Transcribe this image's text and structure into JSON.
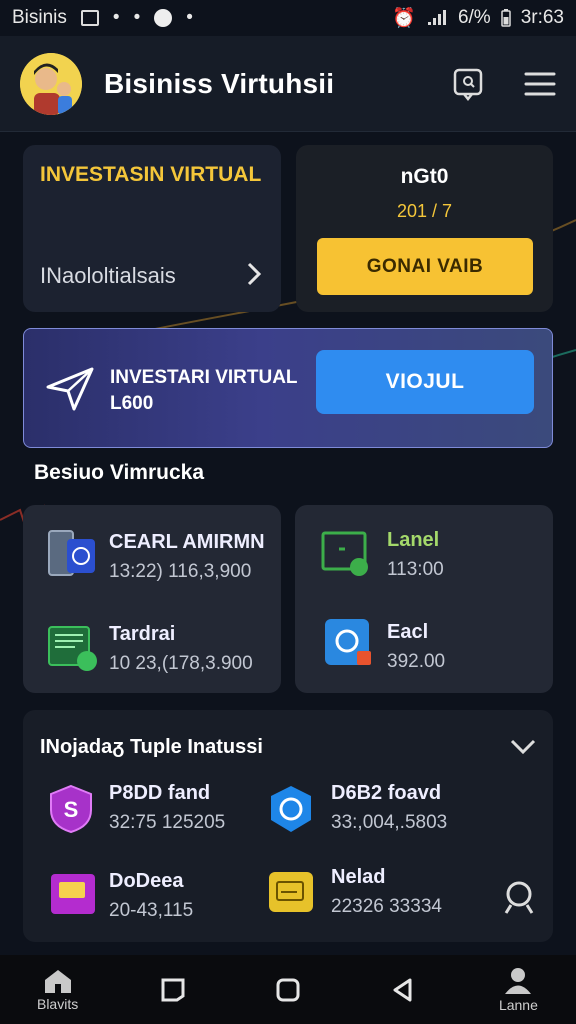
{
  "status_bar": {
    "carrier": "Bisinis",
    "battery": "6/%",
    "time": "3r:63"
  },
  "app_bar": {
    "title": "Bisiniss Virtuhsii"
  },
  "cards": {
    "invest_card": {
      "title": "INVESTASIN VIRTUAL",
      "subtitle": "INaololtialsais"
    },
    "balance_card": {
      "title": "nGt0",
      "value": "201 / 7",
      "button_label": "GONAI VAIB"
    },
    "banner": {
      "line1": "INVESTARI VIRTUAL",
      "line2": "L600",
      "button_label": "VIOJUL"
    }
  },
  "section_title": "Besiuo Vimrucka",
  "asset_cards": [
    {
      "items": [
        {
          "title": "CEARL AMIRMN",
          "value": "13:22) 116,3,900"
        },
        {
          "title": "Tardrai",
          "value": "10 23,(178,3.900"
        }
      ]
    },
    {
      "items": [
        {
          "title": "Lanel",
          "value": "113:00"
        },
        {
          "title": "Eacl",
          "value": "392.00"
        }
      ]
    }
  ],
  "list_section": {
    "title": "INojadaᵹ Tuple Inatussi",
    "items": [
      {
        "title": "P8DD  fand",
        "value": "32:75 125205"
      },
      {
        "title": "D6B2 foavd",
        "value": "33:,004,.5803"
      },
      {
        "title": "DoDeea",
        "value": "20-43,115"
      },
      {
        "title": "Nelad",
        "value": "22326 33334"
      }
    ]
  },
  "bottom_nav": {
    "home_label": "Blavits",
    "profile_label": "Lanne"
  },
  "colors": {
    "accent_yellow": "#f7c233",
    "accent_blue": "#2f8cf0",
    "background": "#0d121c",
    "card": "#1c2230"
  }
}
